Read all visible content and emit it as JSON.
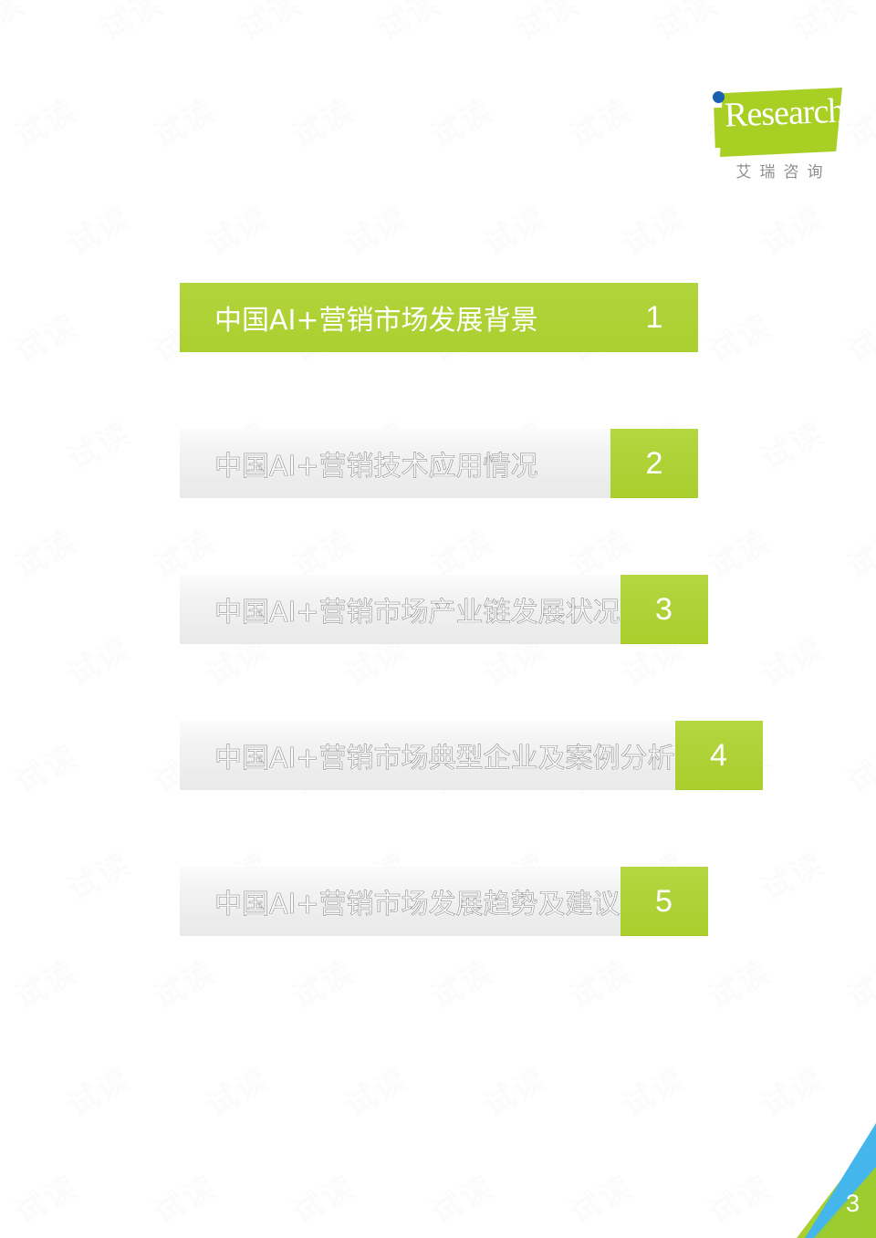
{
  "document": {
    "page_number": "3",
    "watermark_text": "试读"
  },
  "logo": {
    "wordmark": "Research",
    "i_letter": "i",
    "subtitle": "艾瑞咨询",
    "green": "#a8cf23",
    "dot_blue": "#1b5fb0"
  },
  "colors": {
    "accent_green": "#aed136",
    "bar_gray": "#eeeeee",
    "corner_blue": "#45b6ec",
    "corner_green": "#a8cf23",
    "text_gray": "#8e8e8e"
  },
  "toc": {
    "rows": [
      {
        "label": "中国AI+营销市场发展背景",
        "number": "1",
        "state": "active"
      },
      {
        "label": "中国AI+营销技术应用情况",
        "number": "2",
        "state": "normal"
      },
      {
        "label": "中国AI+营销市场产业链发展状况",
        "number": "3",
        "state": "normal"
      },
      {
        "label": "中国AI+营销市场典型企业及案例分析",
        "number": "4",
        "state": "normal"
      },
      {
        "label": "中国AI+营销市场发展趋势及建议",
        "number": "5",
        "state": "normal"
      }
    ]
  }
}
